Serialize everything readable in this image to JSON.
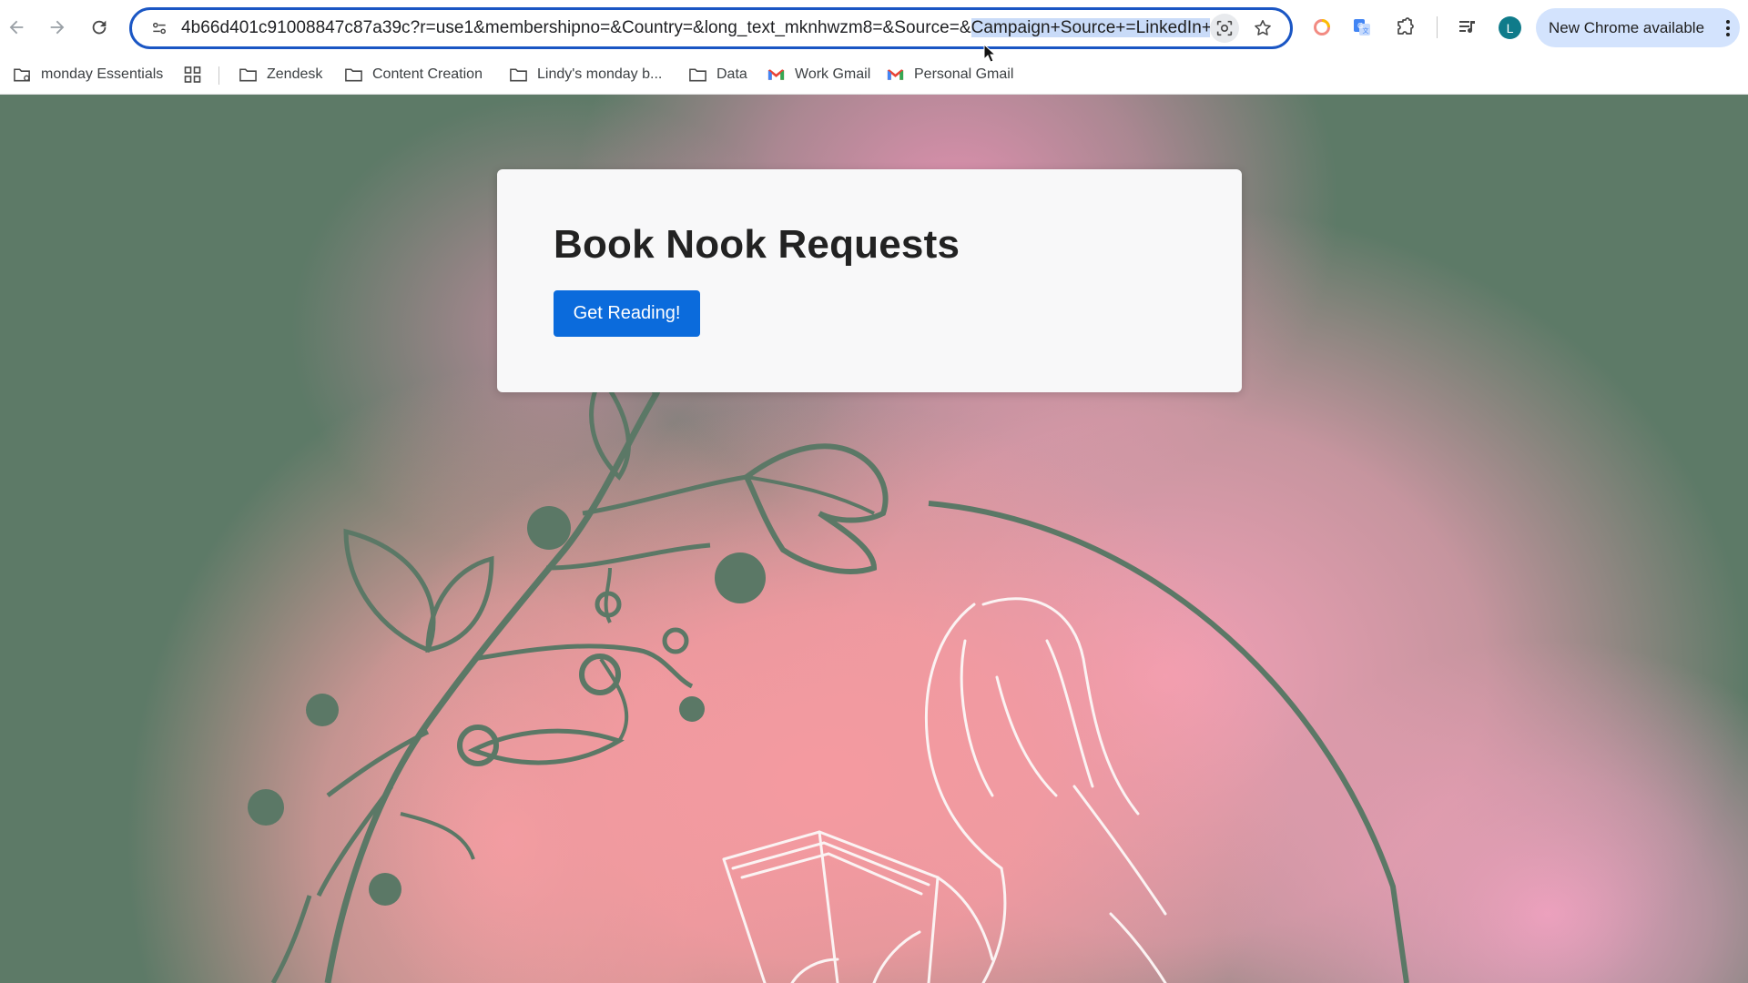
{
  "browser": {
    "url_prefix": "4b66d401c91008847c87a39c?r=use1&membershipno=&Country=&long_text_mknhwzm8=&Source=&",
    "url_selected": "Campaign+Source+=LinkedIn+",
    "profile_initial": "L",
    "update_label": "New Chrome available",
    "icons": [
      "back-arrow-icon",
      "forward-arrow-icon",
      "reload-icon",
      "site-settings-icon",
      "lens-icon",
      "bookmark-star-icon",
      "extension-ring-icon",
      "translate-icon",
      "extensions-puzzle-icon",
      "media-queue-icon",
      "kebab-menu-icon"
    ]
  },
  "bookmarks": [
    {
      "label": "monday Essentials",
      "icon": "folder-gear-icon"
    },
    {
      "label": "",
      "icon": "apps-grid-icon"
    },
    {
      "label": "Zendesk",
      "icon": "folder-icon"
    },
    {
      "label": "Content Creation",
      "icon": "folder-icon"
    },
    {
      "label": "Lindy's monday b...",
      "icon": "folder-icon"
    },
    {
      "label": "Data",
      "icon": "folder-icon"
    },
    {
      "label": "Work Gmail",
      "icon": "gmail-icon"
    },
    {
      "label": "Personal Gmail",
      "icon": "gmail-icon"
    }
  ],
  "form": {
    "title": "Book Nook Requests",
    "button_label": "Get Reading!"
  },
  "colors": {
    "accent": "#0b6bdc",
    "omnibox_border": "#1a56c4",
    "background_green": "#5d7a67",
    "background_pink": "#f59aa0"
  }
}
